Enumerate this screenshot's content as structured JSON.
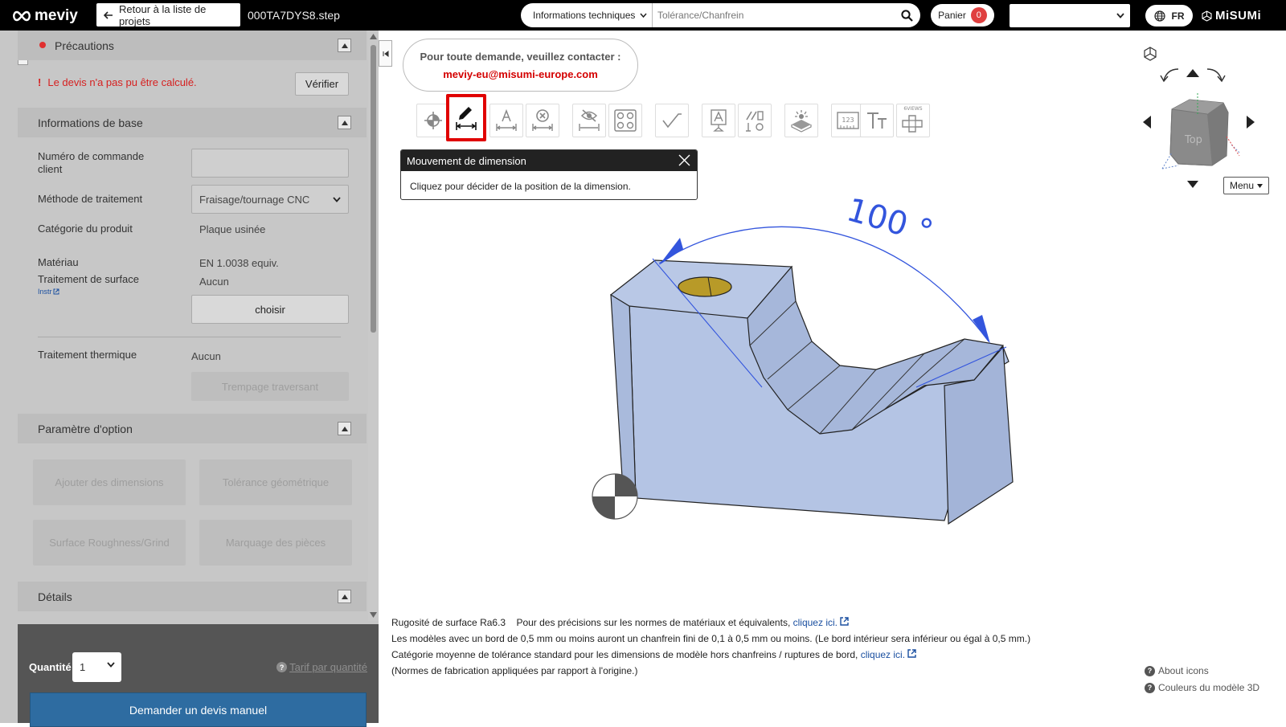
{
  "header": {
    "logo_text": "meviy",
    "back_label": "Retour à la liste de projets",
    "filename": "000TA7DYS8.step",
    "search_category": "Informations techniques",
    "search_placeholder": "Tolérance/Chanfrein",
    "cart_label": "Panier",
    "cart_count": "0",
    "lang": "FR",
    "brand": "MiSUMi"
  },
  "sidebar": {
    "precautions": {
      "title": "Précautions",
      "warning_mark": "!",
      "warning": "Le devis n'a pas pu être calculé.",
      "verify_label": "Vérifier"
    },
    "basic_info": {
      "title": "Informations de base",
      "order_number_label": "Numéro de commande client",
      "order_number_value": "",
      "method_label": "Méthode de traitement",
      "method_value": "Fraisage/tournage CNC",
      "category_label": "Catégorie du produit",
      "category_value": "Plaque usinée",
      "material_label": "Matériau",
      "material_value": "EN 1.0038 equiv.",
      "surface_label": "Traitement de surface",
      "surface_link": "Instr",
      "surface_value": "Aucun",
      "choose_label": "choisir",
      "heat_label": "Traitement thermique",
      "heat_value": "Aucun",
      "heat_button": "Trempage traversant"
    },
    "options": {
      "title": "Paramètre d'option",
      "buttons": [
        "Ajouter des dimensions",
        "Tolérance géométrique",
        "Surface Roughness/Grind",
        "Marquage des pièces"
      ]
    },
    "details": {
      "title": "Détails"
    },
    "bottom": {
      "qty_label": "Quantité",
      "qty_value": "1",
      "tarif_label": "Tarif par quantité",
      "quote_button": "Demander un devis manuel"
    }
  },
  "viewer": {
    "contact_line1": "Pour toute demande, veuillez contacter :",
    "contact_email": "meviy-eu@misumi-europe.com",
    "tooltip": {
      "title": "Mouvement de dimension",
      "body": "Cliquez pour décider de la position de la dimension."
    },
    "dimension_label": "100 °",
    "cube_face": "Top",
    "tool_label_6views": "6VIEWS",
    "menu_label": "Menu",
    "notes": {
      "roughness": "Rugosité de surface Ra6.3",
      "standards_text": "Pour des précisions sur les normes de matériaux et équivalents,",
      "link1": "cliquez ici.",
      "chamfer": "Les modèles avec un bord de 0,5 mm ou moins auront un chanfrein fini de 0,1 à 0,5 mm ou moins. (Le bord intérieur sera inférieur ou égal à 0,5 mm.)",
      "tolerance": "Catégorie moyenne de tolérance standard pour les dimensions de modèle hors chanfreins / ruptures de bord,",
      "link2": "cliquez ici.",
      "origin": "(Normes de fabrication appliquées par rapport à l'origine.)"
    },
    "help": {
      "about_icons": "About icons",
      "colors": "Couleurs du modèle 3D"
    }
  },
  "colors": {
    "model_fill": "#b4c4e4",
    "dimension_line": "#3355dd",
    "hole": "#b89a28",
    "accent_red": "#e00000",
    "quote_button": "#2e6ca1"
  }
}
